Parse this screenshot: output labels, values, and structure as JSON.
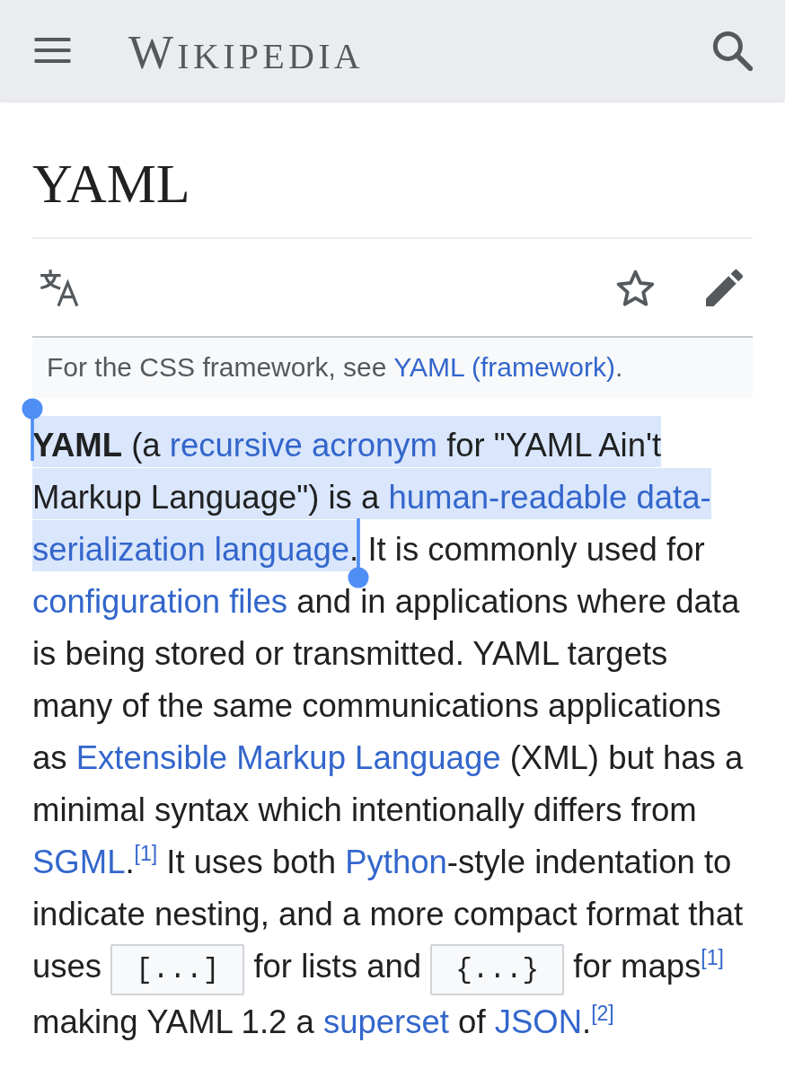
{
  "header": {
    "logo": "WIKIPEDIA"
  },
  "article": {
    "title": "YAML",
    "toolbar": {
      "watched": false
    },
    "hatnote": [
      {
        "kind": "text",
        "text": "For the CSS framework, see "
      },
      {
        "kind": "link",
        "text": "YAML (framework)"
      },
      {
        "kind": "text",
        "text": "."
      }
    ],
    "paragraph": [
      {
        "kind": "bold",
        "text": "YAML",
        "selected": true
      },
      {
        "kind": "text",
        "text": " (a ",
        "selected": true
      },
      {
        "kind": "link",
        "text": "recursive acronym",
        "selected": true
      },
      {
        "kind": "text",
        "text": " for \"YAML Ain't Markup Language\") is a ",
        "selected": true
      },
      {
        "kind": "link",
        "text": "human-readable data-",
        "selected": true
      },
      {
        "kind": "link",
        "text": "serialization language",
        "selected": true
      },
      {
        "kind": "text",
        "text": ".",
        "selected": true
      },
      {
        "kind": "text",
        "text": " It is commonly used for ",
        "selected": false
      },
      {
        "kind": "link",
        "text": "configuration files",
        "selected": false
      },
      {
        "kind": "text",
        "text": " and in applications where data is being stored or transmitted. YAML targets many of the same communications applications as ",
        "selected": false
      },
      {
        "kind": "link",
        "text": "Extensible Markup Language",
        "selected": false
      },
      {
        "kind": "text",
        "text": " (XML) but has a minimal syntax which intentionally differs from ",
        "selected": false
      },
      {
        "kind": "link",
        "text": "SGML",
        "selected": false
      },
      {
        "kind": "text",
        "text": ".",
        "selected": false
      },
      {
        "kind": "ref",
        "text": "[1]",
        "selected": false
      },
      {
        "kind": "text",
        "text": " It uses both ",
        "selected": false
      },
      {
        "kind": "link",
        "text": "Python",
        "selected": false
      },
      {
        "kind": "text",
        "text": "-style indentation to indicate nesting, and a more compact format that uses ",
        "selected": false
      },
      {
        "kind": "code",
        "text": "[...]",
        "selected": false
      },
      {
        "kind": "text",
        "text": " for lists and ",
        "selected": false
      },
      {
        "kind": "code",
        "text": "{...}",
        "selected": false
      },
      {
        "kind": "text",
        "text": " for maps",
        "selected": false
      },
      {
        "kind": "ref",
        "text": "[1]",
        "selected": false
      },
      {
        "kind": "text",
        "text": " making YAML 1.2 a ",
        "selected": false
      },
      {
        "kind": "link",
        "text": "superset",
        "selected": false
      },
      {
        "kind": "text",
        "text": " of ",
        "selected": false
      },
      {
        "kind": "link",
        "text": "JSON",
        "selected": false
      },
      {
        "kind": "text",
        "text": ".",
        "selected": false
      },
      {
        "kind": "ref",
        "text": "[2]",
        "selected": false
      }
    ]
  }
}
